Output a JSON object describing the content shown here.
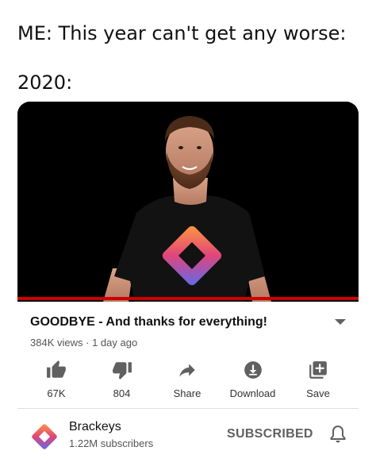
{
  "meme": {
    "line1": "ME: This year can't get any worse:",
    "line2": "2020:"
  },
  "video": {
    "title": "GOODBYE - And thanks for everything!",
    "views": "384K views",
    "age": "1 day ago",
    "separator": "·",
    "progress_color": "#cc0000"
  },
  "actions": [
    {
      "label": "67K",
      "icon": "thumbs-up-icon"
    },
    {
      "label": "804",
      "icon": "thumbs-down-icon"
    },
    {
      "label": "Share",
      "icon": "share-icon"
    },
    {
      "label": "Download",
      "icon": "download-icon"
    },
    {
      "label": "Save",
      "icon": "save-playlist-icon"
    }
  ],
  "channel": {
    "name": "Brackeys",
    "subscribers": "1.22M subscribers",
    "subscribe_state": "SUBSCRIBED",
    "logo_icon": "brackeys-logo-icon",
    "bell_icon": "bell-icon"
  }
}
